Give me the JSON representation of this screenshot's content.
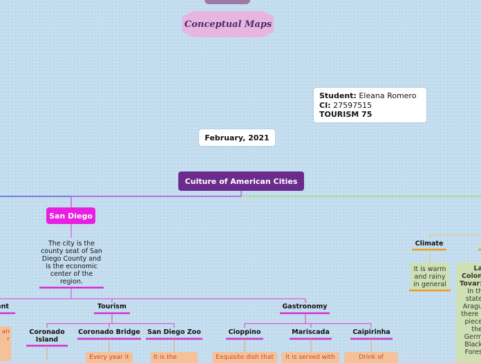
{
  "title": "Conceptual Maps",
  "student": {
    "student_label": "Student:",
    "student_name": "Eleana Romero",
    "ci_label": "CI:",
    "ci_value": "27597515",
    "course": "TOURISM 75"
  },
  "date": "February, 2021",
  "central_topic": "Culture of American Cities",
  "san_diego": {
    "label": "San Diego",
    "description": "The city is the county seat of San Diego County and is the economic center of the region.",
    "branches": {
      "ent": "ent",
      "tourism": "Tourism",
      "gastronomy": "Gastronomy"
    },
    "tourism_items": [
      "Coronado Island",
      "Coronado Bridge",
      "San Diego Zoo"
    ],
    "gastronomy_items": [
      "Cioppino",
      "Mariscada",
      "Caipirinha"
    ],
    "leaf_notes": {
      "left_partial_1": "an",
      "left_partial_2": "r",
      "bridge": "Every year it",
      "zoo": "It is the",
      "cioppino": "Exquisite dish that",
      "mariscada": "It is served with",
      "caipirinha": "Drink of"
    }
  },
  "right_side": {
    "climate_label": "Climate",
    "climate_text": "It is warm and rainy in general",
    "colonia_title_1": "La",
    "colonia_title_2": "Colon",
    "colonia_title_3": "Tovar:",
    "colonia_text_1": "In th",
    "colonia_text_2": "state",
    "colonia_text_3": "Aragu",
    "colonia_text_4": "there i",
    "colonia_text_5": "piece",
    "colonia_text_6": "the",
    "colonia_text_7": "Germ",
    "colonia_text_8": "Black",
    "colonia_text_9": "Fores"
  },
  "colors": {
    "central": "#6a2b8c",
    "san_diego": "#e81ee0",
    "orange_underline": "#f59a16",
    "green_branch": "#a6d65a",
    "blue_branch": "#3b4fd6"
  }
}
